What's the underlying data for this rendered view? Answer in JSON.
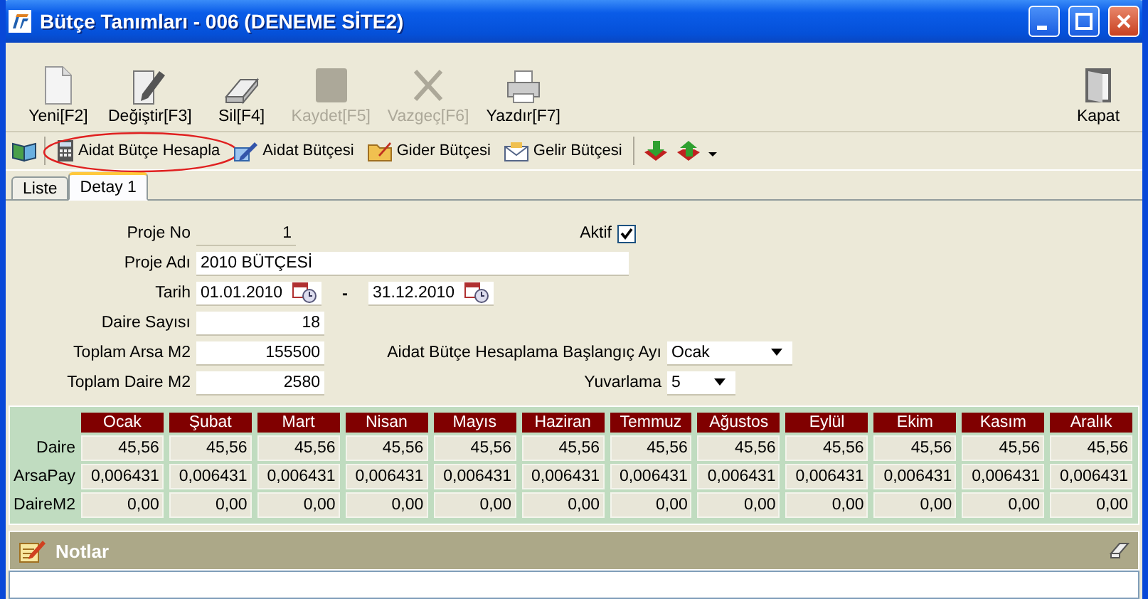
{
  "window": {
    "title": "Bütçe Tanımları - 006 (DENEME SİTE2)"
  },
  "toolbar": {
    "buttons": [
      {
        "label": "Yeni[F2]",
        "kind": "new",
        "disabled": false
      },
      {
        "label": "Değiştir[F3]",
        "kind": "edit",
        "disabled": false
      },
      {
        "label": "Sil[F4]",
        "kind": "delete",
        "disabled": false
      },
      {
        "label": "Kaydet[F5]",
        "kind": "save",
        "disabled": true
      },
      {
        "label": "Vazgeç[F6]",
        "kind": "cancel",
        "disabled": true
      },
      {
        "label": "Yazdır[F7]",
        "kind": "print",
        "disabled": false
      }
    ],
    "close": {
      "label": "Kapat"
    }
  },
  "action_bar": [
    {
      "kind": "book"
    },
    {
      "kind": "calculator",
      "label": "Aidat Bütçe Hesapla",
      "highlighted": true
    },
    {
      "kind": "pen",
      "label": "Aidat Bütçesi",
      "highlighted": false
    },
    {
      "kind": "folder",
      "label": "Gider Bütçesi",
      "highlighted": false
    },
    {
      "kind": "envelope",
      "label": "Gelir Bütçesi",
      "highlighted": false
    },
    {
      "kind": "import"
    },
    {
      "kind": "export"
    },
    {
      "kind": "more"
    }
  ],
  "tabs": [
    {
      "label": "Liste",
      "selected": false
    },
    {
      "label": "Detay 1",
      "selected": true
    }
  ],
  "form": {
    "project_no": {
      "label": "Proje No",
      "value": "1"
    },
    "active": {
      "label": "Aktif",
      "checked": true
    },
    "project_name": {
      "label": "Proje Adı",
      "value": "2010 BÜTÇESİ"
    },
    "date": {
      "label": "Tarih",
      "from": "01.01.2010",
      "separator": "-",
      "to": "31.12.2010"
    },
    "unit_count": {
      "label": "Daire Sayısı",
      "value": "18"
    },
    "total_land": {
      "label": "Toplam Arsa M2",
      "value": "155500"
    },
    "start_month": {
      "label": "Aidat Bütçe Hesaplama Başlangıç Ayı",
      "value": "Ocak"
    },
    "total_unit_area": {
      "label": "Toplam Daire M2",
      "value": "2580"
    },
    "rounding": {
      "label": "Yuvarlama",
      "value": "5"
    }
  },
  "grid": {
    "columns": [
      "Ocak",
      "Şubat",
      "Mart",
      "Nisan",
      "Mayıs",
      "Haziran",
      "Temmuz",
      "Ağustos",
      "Eylül",
      "Ekim",
      "Kasım",
      "Aralık"
    ],
    "rows": [
      {
        "label": "Daire",
        "values": [
          "45,56",
          "45,56",
          "45,56",
          "45,56",
          "45,56",
          "45,56",
          "45,56",
          "45,56",
          "45,56",
          "45,56",
          "45,56",
          "45,56"
        ]
      },
      {
        "label": "ArsaPay",
        "values": [
          "0,006431",
          "0,006431",
          "0,006431",
          "0,006431",
          "0,006431",
          "0,006431",
          "0,006431",
          "0,006431",
          "0,006431",
          "0,006431",
          "0,006431",
          "0,006431"
        ]
      },
      {
        "label": "DaireM2",
        "values": [
          "0,00",
          "0,00",
          "0,00",
          "0,00",
          "0,00",
          "0,00",
          "0,00",
          "0,00",
          "0,00",
          "0,00",
          "0,00",
          "0,00"
        ]
      }
    ]
  },
  "notes": {
    "title": "Notlar"
  }
}
